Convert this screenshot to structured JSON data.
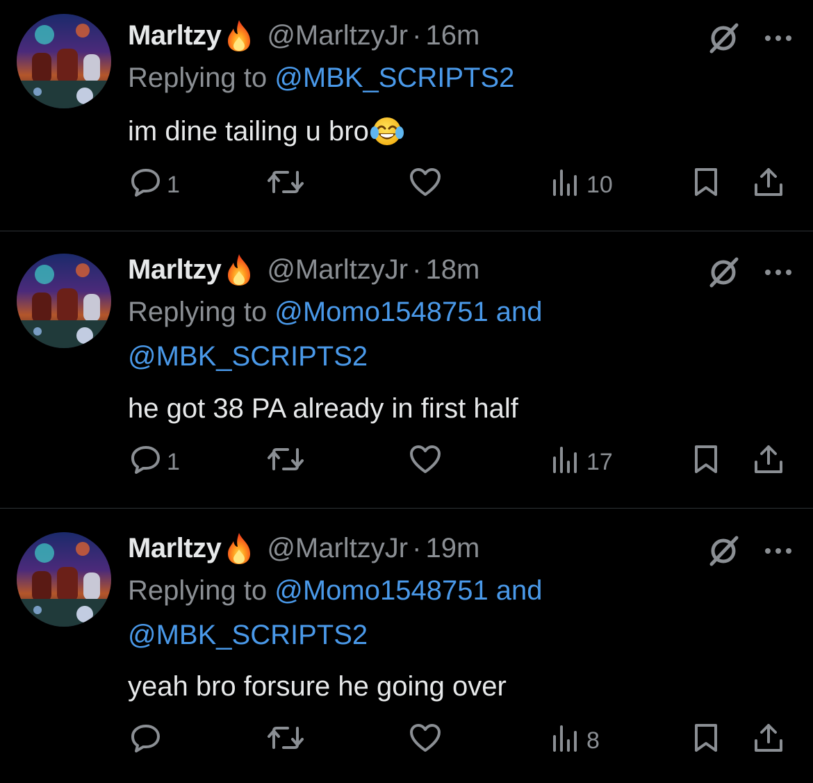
{
  "tweets": [
    {
      "display_name": "Marltzy",
      "name_emoji": "fire-emoji",
      "handle": "@MarltzyJr",
      "dot": "·",
      "time": "16m",
      "replying_prefix": "Replying to ",
      "replying_to": "@MBK_SCRIPTS2",
      "replying_to_2": "",
      "text": "im dine tailing u bro",
      "text_emoji": "face-with-tears-of-joy",
      "reply_count": "1",
      "retweet_count": "",
      "like_count": "",
      "view_count": "10"
    },
    {
      "display_name": "Marltzy",
      "name_emoji": "fire-emoji",
      "handle": "@MarltzyJr",
      "dot": "·",
      "time": "18m",
      "replying_prefix": "Replying to ",
      "replying_to": "@Momo1548751 and",
      "replying_to_2": "@MBK_SCRIPTS2",
      "text": "he got 38 PA already in first half",
      "text_emoji": "",
      "reply_count": "1",
      "retweet_count": "",
      "like_count": "",
      "view_count": "17"
    },
    {
      "display_name": "Marltzy",
      "name_emoji": "fire-emoji",
      "handle": "@MarltzyJr",
      "dot": "·",
      "time": "19m",
      "replying_prefix": "Replying to ",
      "replying_to": "@Momo1548751 and",
      "replying_to_2": "@MBK_SCRIPTS2",
      "text": "yeah bro forsure he going over",
      "text_emoji": "",
      "reply_count": "",
      "retweet_count": "",
      "like_count": "",
      "view_count": "8"
    }
  ],
  "icons": {
    "grok": "grok-icon",
    "more": "more-icon",
    "reply": "reply-icon",
    "retweet": "retweet-icon",
    "like": "like-icon",
    "views": "views-icon",
    "bookmark": "bookmark-icon",
    "share": "share-icon"
  },
  "colors": {
    "background": "#000000",
    "text": "#e7e9ea",
    "muted": "#8b8f94",
    "link": "#4a99e9",
    "divider": "#2f3336"
  }
}
